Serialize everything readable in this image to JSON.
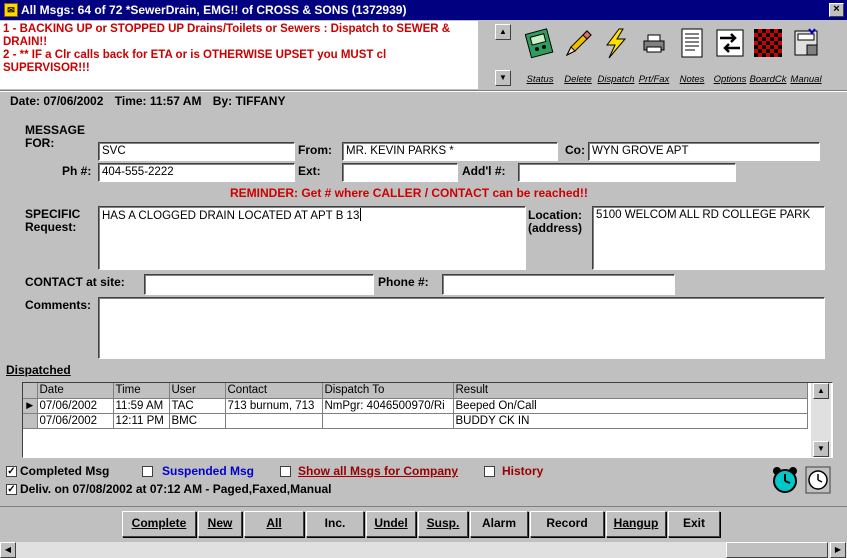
{
  "window": {
    "title": "All Msgs: 64 of 72 *SewerDrain, EMG!! of CROSS & SONS (1372939)"
  },
  "alert": {
    "lines": [
      "1 - BACKING UP or STOPPED UP Drains/Toilets or Sewers : Dispatch to SEWER & DRAIN!!",
      "2 - ** IF a Clr calls back for ETA or is OTHERWISE UPSET you MUST cl SUPERVISOR!!!"
    ]
  },
  "toolbar": {
    "status": "Status",
    "delete": "Delete",
    "dispatch": "Dispatch",
    "prtfax": "Prt/Fax",
    "notes": "Notes",
    "options": "Options",
    "boardck": "BoardCk",
    "manual": "Manual"
  },
  "header": {
    "date_label": "Date: 07/06/2002",
    "time_label": "Time: 11:57 AM",
    "by_label": "By: TIFFANY"
  },
  "form": {
    "message_for_label": "MESSAGE FOR:",
    "message_for": "SVC",
    "from_label": "From:",
    "from": "MR. KEVIN PARKS *",
    "co_label": "Co:",
    "co": "WYN GROVE APT",
    "ph_label": "Ph #:",
    "ph": "404-555-2222",
    "ext_label": "Ext:",
    "ext": "",
    "addl_label": "Add'l #:",
    "addl": "",
    "reminder": "REMINDER:  Get # where CALLER / CONTACT can be reached!!",
    "specific_label": "SPECIFIC Request:",
    "specific": "HAS A CLOGGED DRAIN LOCATED AT APT B 13",
    "location_label": "Location: (address)",
    "location": "5100  WELCOM ALL RD   COLLEGE PARK",
    "contact_label": "CONTACT at site:",
    "contact": "",
    "phone_label": "Phone #:",
    "phone": "",
    "comments_label": "Comments:",
    "comments": ""
  },
  "dispatched": {
    "title": "Dispatched",
    "columns": [
      "Date",
      "Time",
      "User",
      "Contact",
      "Dispatch To",
      "Result"
    ],
    "rows": [
      [
        "07/06/2002",
        "11:59 AM",
        "TAC",
        "713 burnum, 713",
        "NmPgr: 4046500970/Ri",
        "Beeped On/Call"
      ],
      [
        "07/06/2002",
        "12:11 PM",
        "BMC",
        "",
        "",
        "BUDDY CK IN"
      ]
    ]
  },
  "options": {
    "completed": "Completed Msg",
    "suspended": "Suspended Msg",
    "show_all": "Show all Msgs for Company",
    "history": "History",
    "delivered": "Deliv. on 07/08/2002 at 07:12 AM - Paged,Faxed,Manual"
  },
  "buttons": {
    "complete": "Complete",
    "new": "New",
    "all": "All",
    "inc": "Inc.",
    "undel": "Undel",
    "susp": "Susp.",
    "alarm": "Alarm",
    "record": "Record",
    "hangup": "Hangup",
    "exit": "Exit"
  },
  "colors": {
    "title_bar": "#000080",
    "alert_text": "#cc0000",
    "suspended_text": "#0000cc",
    "show_all_text": "#990000",
    "face": "#c0c0c0"
  },
  "icons": [
    "app-icon",
    "status-icon",
    "delete-icon",
    "dispatch-icon",
    "printer-icon",
    "notes-icon",
    "options-icon",
    "boardck-icon",
    "manual-icon",
    "alarm-clock-icon",
    "clock-icon"
  ]
}
